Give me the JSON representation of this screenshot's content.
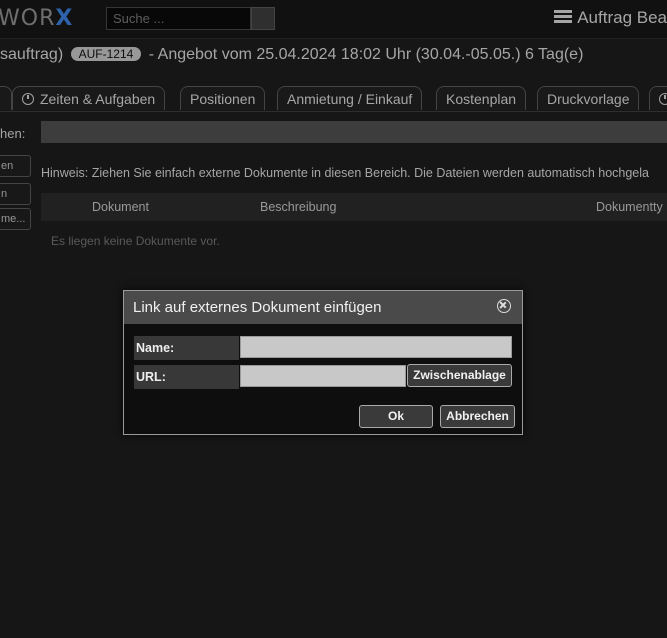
{
  "header": {
    "logo_text": "WOR",
    "logo_x": "X",
    "search": {
      "placeholder": "Suche ..."
    },
    "menu_label": "Auftrag Bea"
  },
  "title": {
    "prefix": "sauftrag)",
    "badge": "AUF-1214",
    "text": "- Angebot vom 25.04.2024 18:02 Uhr (30.04.-05.05.) 6 Tag(e)"
  },
  "tabs": [
    {
      "label": "Zeiten & Aufgaben"
    },
    {
      "label": "Positionen"
    },
    {
      "label": "Anmietung / Einkauf"
    },
    {
      "label": "Kostenplan"
    },
    {
      "label": "Druckvorlage"
    }
  ],
  "side": {
    "label": "hen:",
    "buttons": [
      "en",
      "n",
      "me..."
    ]
  },
  "content": {
    "hint": "Hinweis: Ziehen Sie einfach externe Dokumente in diesen Bereich. Die Dateien werden automatisch hochgela",
    "columns": [
      "Dokument",
      "Beschreibung",
      "Dokumentty"
    ],
    "empty_text": "Es liegen keine Dokumente vor."
  },
  "dialog": {
    "title": "Link auf externes Dokument einfügen",
    "name_label": "Name:",
    "name_value": "",
    "url_label": "URL:",
    "url_value": "",
    "clipboard_button": "Zwischenablage",
    "ok_button": "Ok",
    "cancel_button": "Abbrechen"
  }
}
